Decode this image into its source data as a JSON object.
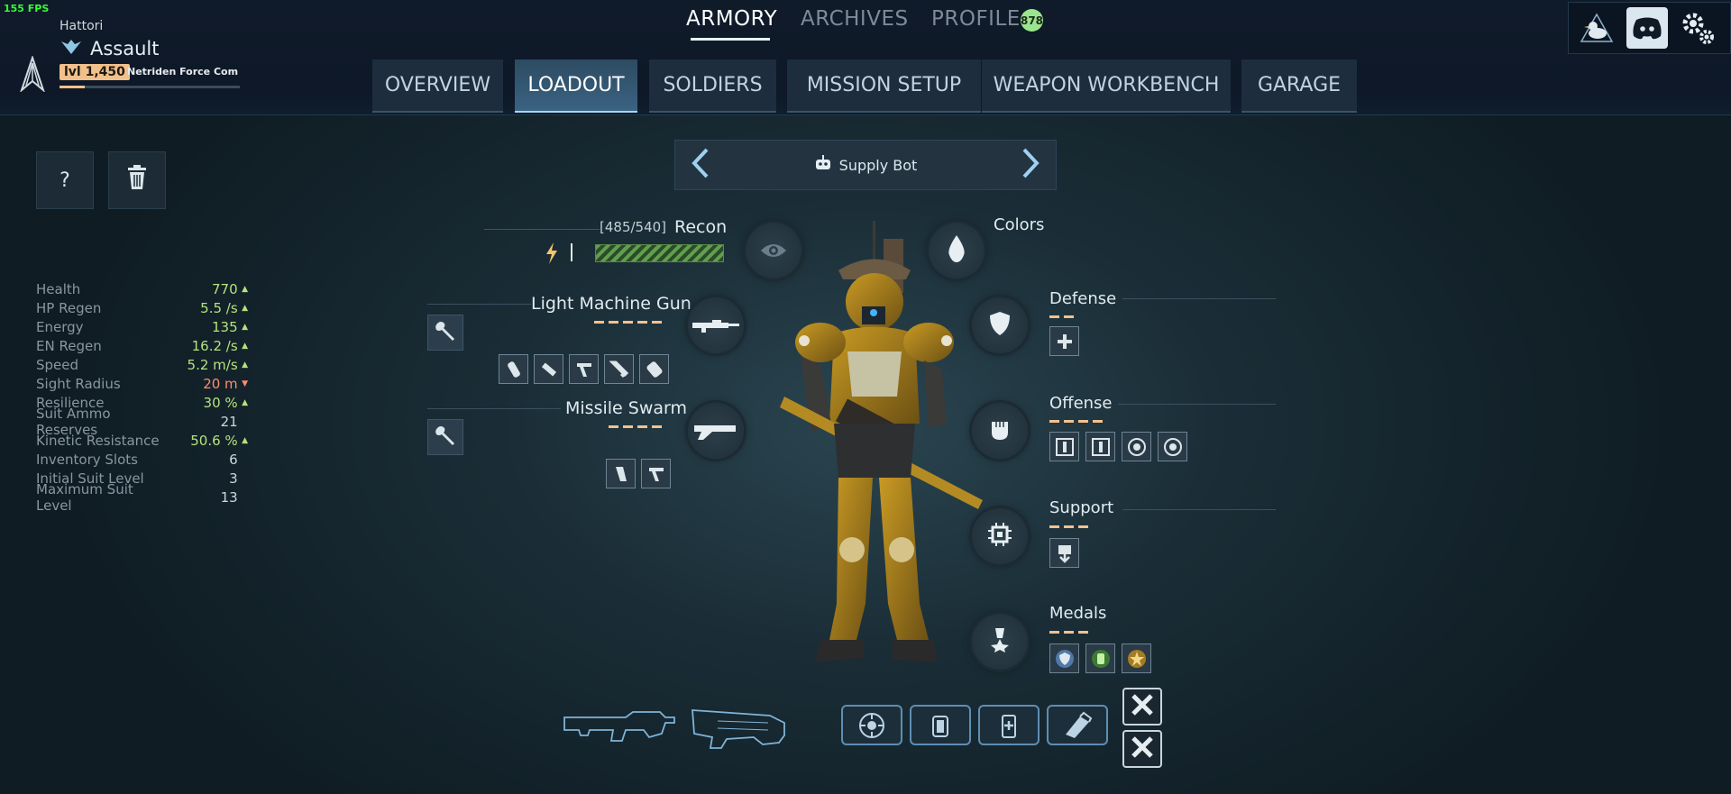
{
  "hud": {
    "fps": "155 FPS"
  },
  "player": {
    "name": "Hattori",
    "class": "Assault",
    "level": "lvl 1,450",
    "rank_title": "Netriden Force Commander",
    "xp_progress": 0.14
  },
  "top_nav": {
    "tabs": [
      {
        "label": "ARMORY",
        "active": true
      },
      {
        "label": "ARCHIVES",
        "active": false
      },
      {
        "label": "PROFILE",
        "active": false
      }
    ],
    "profile_badge": "878"
  },
  "sub_nav": {
    "tabs": [
      {
        "label": "OVERVIEW"
      },
      {
        "label": "LOADOUT",
        "active": true
      },
      {
        "label": "SOLDIERS"
      },
      {
        "label": "MISSION SETUP"
      },
      {
        "label": "WEAPON WORKBENCH"
      },
      {
        "label": "GARAGE"
      }
    ]
  },
  "toolbar": {
    "help_label": "?"
  },
  "stats": [
    {
      "label": "Health",
      "value": "770",
      "trend": "up"
    },
    {
      "label": "HP Regen",
      "value": "5.5 /s",
      "trend": "up"
    },
    {
      "label": "Energy",
      "value": "135",
      "trend": "up"
    },
    {
      "label": "EN Regen",
      "value": "16.2 /s",
      "trend": "up"
    },
    {
      "label": "Speed",
      "value": "5.2 m/s",
      "trend": "up"
    },
    {
      "label": "Sight Radius",
      "value": "20 m",
      "trend": "down"
    },
    {
      "label": "Resilience",
      "value": "30 %",
      "trend": "up"
    },
    {
      "label": "Suit Ammo Reserves",
      "value": "21",
      "trend": "none"
    },
    {
      "label": "Kinetic Resistance",
      "value": "50.6 %",
      "trend": "up"
    },
    {
      "label": "Inventory Slots",
      "value": "6",
      "trend": "none"
    },
    {
      "label": "Initial Suit Level",
      "value": "3",
      "trend": "none"
    },
    {
      "label": "Maximum Suit Level",
      "value": "13",
      "trend": "none"
    }
  ],
  "bot_selector": {
    "label": "Supply Bot"
  },
  "suit": {
    "capacity": "[485/540]",
    "name": "Recon",
    "energy_fill": 1.0
  },
  "weapons": {
    "primary": {
      "name": "Light Machine Gun",
      "dashes": 5
    },
    "secondary": {
      "name": "Missile Swarm",
      "dashes": 4
    }
  },
  "right_sections": {
    "colors": "Colors",
    "defense": {
      "label": "Defense",
      "dashes": 2
    },
    "offense": {
      "label": "Offense",
      "dashes": 4
    },
    "support": {
      "label": "Support",
      "dashes": 3
    },
    "medals": {
      "label": "Medals",
      "dashes": 3
    }
  },
  "colors": {
    "accent": "#f4c18f",
    "energy": "#5fa04d",
    "stat_up": "#b4e37c",
    "stat_down": "#ff8c70",
    "active_tab": "#3a6382"
  },
  "icons": [
    "logo-icon",
    "wings-icon",
    "duck-icon",
    "discord-icon",
    "gear-icon",
    "trash-icon",
    "robot-icon",
    "eye-icon",
    "drop-icon",
    "shield-icon",
    "fist-icon",
    "chip-icon",
    "medal-icon",
    "wrench-icon",
    "bolt-icon"
  ]
}
